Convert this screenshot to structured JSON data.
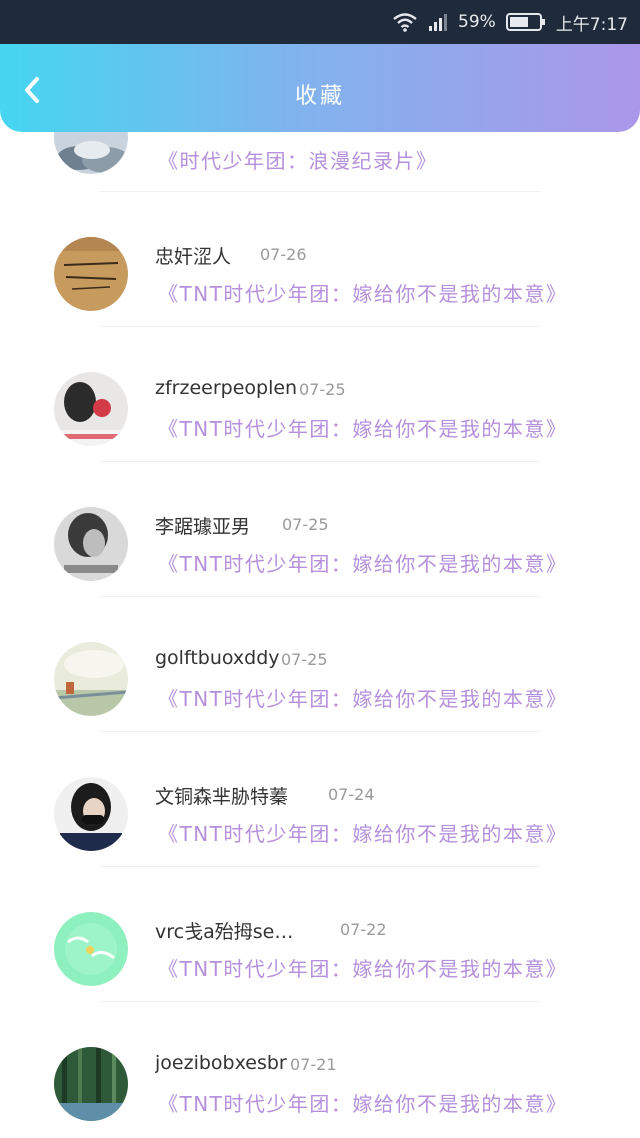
{
  "status_bar": {
    "battery": "59%",
    "time": "上午7:17"
  },
  "header": {
    "title": "收藏"
  },
  "items": [
    {
      "name": "",
      "date": "",
      "title": "《时代少年团：浪漫纪录片》",
      "avatar_icon": "avatar-cloud-icon"
    },
    {
      "name": "忠奸涩人",
      "date": "07-26",
      "title": "《TNT时代少年团：嫁给你不是我的本意》",
      "avatar_icon": "avatar-handwriting-icon"
    },
    {
      "name": "zfrzeerpeoplen",
      "date": "07-25",
      "title": "《TNT时代少年团：嫁给你不是我的本意》",
      "avatar_icon": "avatar-photo-icon"
    },
    {
      "name": "李踞璩亚男",
      "date": "07-25",
      "title": "《TNT时代少年团：嫁给你不是我的本意》",
      "avatar_icon": "avatar-portrait-icon"
    },
    {
      "name": "golftbuoxddy",
      "date": "07-25",
      "title": "《TNT时代少年团：嫁给你不是我的本意》",
      "avatar_icon": "avatar-landscape-icon"
    },
    {
      "name": "文铜森芈胁特蓁",
      "date": "07-24",
      "title": "《TNT时代少年团：嫁给你不是我的本意》",
      "avatar_icon": "avatar-masked-person-icon"
    },
    {
      "name": "vrc戋a殆拇se…",
      "date": "07-22",
      "title": "《TNT时代少年团：嫁给你不是我的本意》",
      "avatar_icon": "avatar-green-sticker-icon"
    },
    {
      "name": "joezibobxesbr",
      "date": "07-21",
      "title": "《TNT时代少年团：嫁给你不是我的本意》",
      "avatar_icon": "avatar-forest-icon"
    }
  ]
}
